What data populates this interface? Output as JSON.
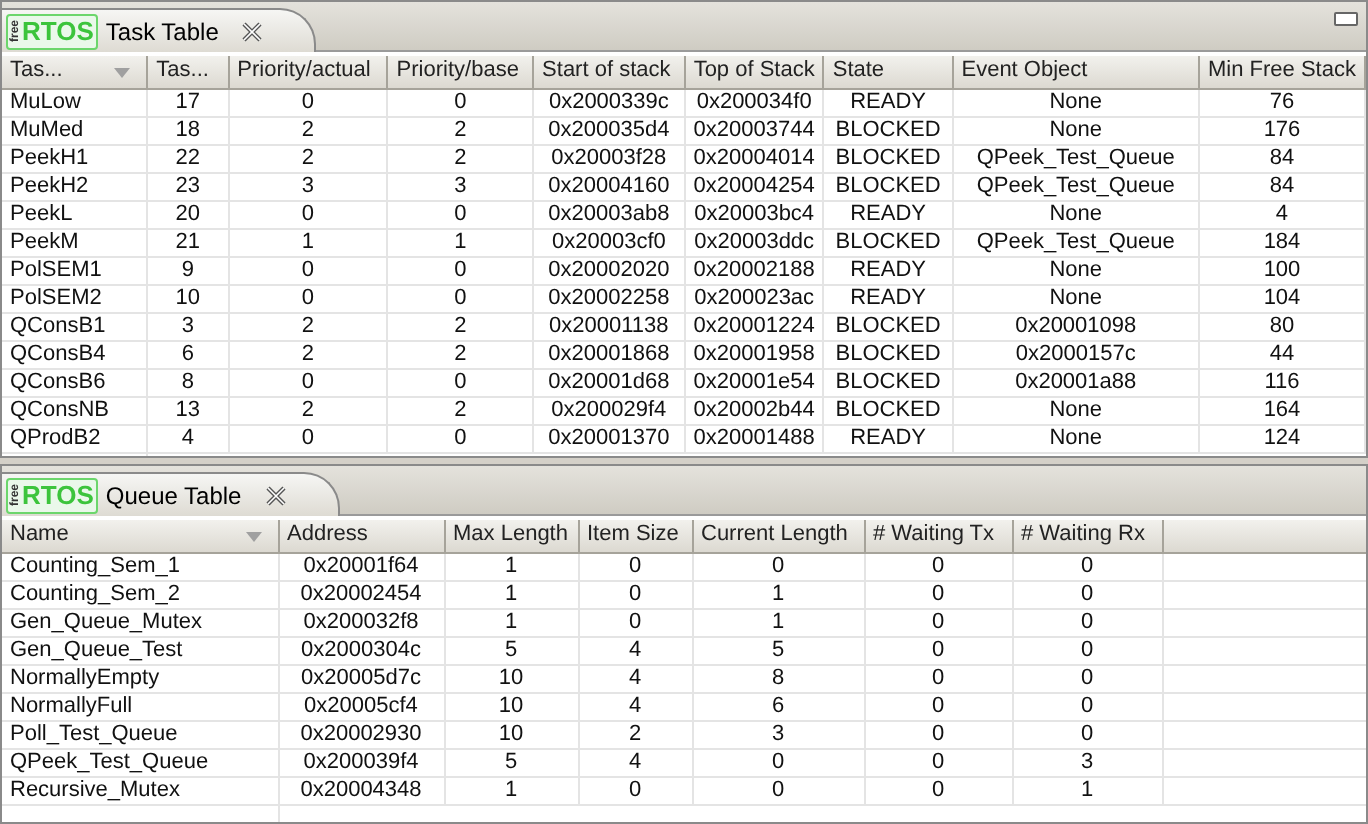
{
  "task_panel": {
    "logo": {
      "small": "free",
      "text": "RTOS"
    },
    "tab_label": "Task Table",
    "columns": [
      {
        "label": "Tas...",
        "sorted": true
      },
      {
        "label": "Tas...",
        "sorted": false
      },
      {
        "label": "Priority/actual",
        "sorted": false
      },
      {
        "label": "Priority/base",
        "sorted": false
      },
      {
        "label": "Start of stack",
        "sorted": false
      },
      {
        "label": "Top of Stack",
        "sorted": false
      },
      {
        "label": "State",
        "sorted": false
      },
      {
        "label": "Event Object",
        "sorted": false
      },
      {
        "label": "Min Free Stack",
        "sorted": false
      }
    ],
    "rows": [
      [
        "MuLow",
        "17",
        "0",
        "0",
        "0x2000339c",
        "0x200034f0",
        "READY",
        "None",
        "76"
      ],
      [
        "MuMed",
        "18",
        "2",
        "2",
        "0x200035d4",
        "0x20003744",
        "BLOCKED",
        "None",
        "176"
      ],
      [
        "PeekH1",
        "22",
        "2",
        "2",
        "0x20003f28",
        "0x20004014",
        "BLOCKED",
        "QPeek_Test_Queue",
        "84"
      ],
      [
        "PeekH2",
        "23",
        "3",
        "3",
        "0x20004160",
        "0x20004254",
        "BLOCKED",
        "QPeek_Test_Queue",
        "84"
      ],
      [
        "PeekL",
        "20",
        "0",
        "0",
        "0x20003ab8",
        "0x20003bc4",
        "READY",
        "None",
        "4"
      ],
      [
        "PeekM",
        "21",
        "1",
        "1",
        "0x20003cf0",
        "0x20003ddc",
        "BLOCKED",
        "QPeek_Test_Queue",
        "184"
      ],
      [
        "PolSEM1",
        "9",
        "0",
        "0",
        "0x20002020",
        "0x20002188",
        "READY",
        "None",
        "100"
      ],
      [
        "PolSEM2",
        "10",
        "0",
        "0",
        "0x20002258",
        "0x200023ac",
        "READY",
        "None",
        "104"
      ],
      [
        "QConsB1",
        "3",
        "2",
        "2",
        "0x20001138",
        "0x20001224",
        "BLOCKED",
        "0x20001098",
        "80"
      ],
      [
        "QConsB4",
        "6",
        "2",
        "2",
        "0x20001868",
        "0x20001958",
        "BLOCKED",
        "0x2000157c",
        "44"
      ],
      [
        "QConsB6",
        "8",
        "0",
        "0",
        "0x20001d68",
        "0x20001e54",
        "BLOCKED",
        "0x20001a88",
        "116"
      ],
      [
        "QConsNB",
        "13",
        "2",
        "2",
        "0x200029f4",
        "0x20002b44",
        "BLOCKED",
        "None",
        "164"
      ],
      [
        "QProdB2",
        "4",
        "0",
        "0",
        "0x20001370",
        "0x20001488",
        "READY",
        "None",
        "124"
      ]
    ]
  },
  "queue_panel": {
    "logo": {
      "small": "free",
      "text": "RTOS"
    },
    "tab_label": "Queue Table",
    "columns": [
      {
        "label": "Name",
        "sorted": true
      },
      {
        "label": "Address",
        "sorted": false
      },
      {
        "label": "Max Length",
        "sorted": false
      },
      {
        "label": "Item Size",
        "sorted": false
      },
      {
        "label": "Current Length",
        "sorted": false
      },
      {
        "label": "# Waiting Tx",
        "sorted": false
      },
      {
        "label": "# Waiting Rx",
        "sorted": false
      }
    ],
    "rows": [
      [
        "Counting_Sem_1",
        "0x20001f64",
        "1",
        "0",
        "0",
        "0",
        "0"
      ],
      [
        "Counting_Sem_2",
        "0x20002454",
        "1",
        "0",
        "1",
        "0",
        "0"
      ],
      [
        "Gen_Queue_Mutex",
        "0x200032f8",
        "1",
        "0",
        "1",
        "0",
        "0"
      ],
      [
        "Gen_Queue_Test",
        "0x2000304c",
        "5",
        "4",
        "5",
        "0",
        "0"
      ],
      [
        "NormallyEmpty",
        "0x20005d7c",
        "10",
        "4",
        "8",
        "0",
        "0"
      ],
      [
        "NormallyFull",
        "0x20005cf4",
        "10",
        "4",
        "6",
        "0",
        "0"
      ],
      [
        "Poll_Test_Queue",
        "0x20002930",
        "10",
        "2",
        "3",
        "0",
        "0"
      ],
      [
        "QPeek_Test_Queue",
        "0x200039f4",
        "5",
        "4",
        "0",
        "0",
        "3"
      ],
      [
        "Recursive_Mutex",
        "0x20004348",
        "1",
        "0",
        "0",
        "0",
        "1"
      ]
    ]
  }
}
